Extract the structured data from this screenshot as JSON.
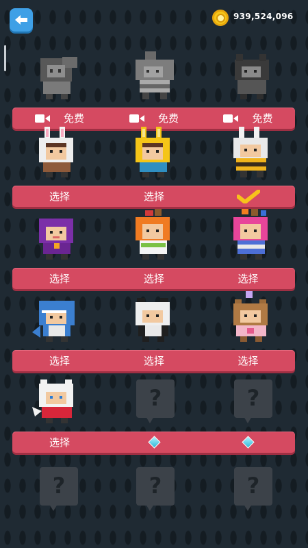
{
  "header": {
    "coins": "939,524,096",
    "back_icon": "back-arrow-icon"
  },
  "rows": [
    {
      "slots": [
        {
          "character": "gray-cat-hoodie",
          "grayscale": true
        },
        {
          "character": "gray-hippo-stripes",
          "grayscale": true
        },
        {
          "character": "gray-wolf",
          "grayscale": true
        }
      ],
      "buttons": [
        {
          "label": "免费",
          "icon": "video-camera-icon"
        },
        {
          "label": "免费",
          "icon": "video-camera-icon"
        },
        {
          "label": "免费",
          "icon": "video-camera-icon"
        }
      ]
    },
    {
      "slots": [
        {
          "character": "white-bunny-hood"
        },
        {
          "character": "yellow-bunny-hood"
        },
        {
          "character": "bunny-bee-costume"
        }
      ],
      "buttons": [
        {
          "label": "选择"
        },
        {
          "label": "选择"
        },
        {
          "label": "",
          "icon": "checkmark-icon",
          "selected": true
        }
      ]
    },
    {
      "slots": [
        {
          "character": "purple-hooded-girl"
        },
        {
          "character": "orange-hair-girl"
        },
        {
          "character": "pink-hair-girl"
        }
      ],
      "buttons": [
        {
          "label": "选择"
        },
        {
          "label": "选择"
        },
        {
          "label": "选择"
        }
      ]
    },
    {
      "slots": [
        {
          "character": "shark-costume"
        },
        {
          "character": "panda-costume"
        },
        {
          "character": "bear-princess"
        }
      ],
      "buttons": [
        {
          "label": "选择"
        },
        {
          "label": "选择"
        },
        {
          "label": "选择"
        }
      ]
    },
    {
      "slots": [
        {
          "character": "white-cat-red-dress"
        },
        {
          "character": "locked",
          "locked": true
        },
        {
          "character": "locked",
          "locked": true
        }
      ],
      "buttons": [
        {
          "label": "选择"
        },
        {
          "label": "",
          "icon": "diamond-icon"
        },
        {
          "label": "",
          "icon": "diamond-icon"
        }
      ]
    },
    {
      "slots": [
        {
          "character": "locked",
          "locked": true
        },
        {
          "character": "locked",
          "locked": true
        },
        {
          "character": "locked",
          "locked": true
        }
      ]
    }
  ],
  "locked_mark": "?",
  "colors": {
    "background": "#1f2a33",
    "bar": "#d54a61",
    "accent_blue": "#3fa0e6",
    "coin": "#f6c81a"
  }
}
